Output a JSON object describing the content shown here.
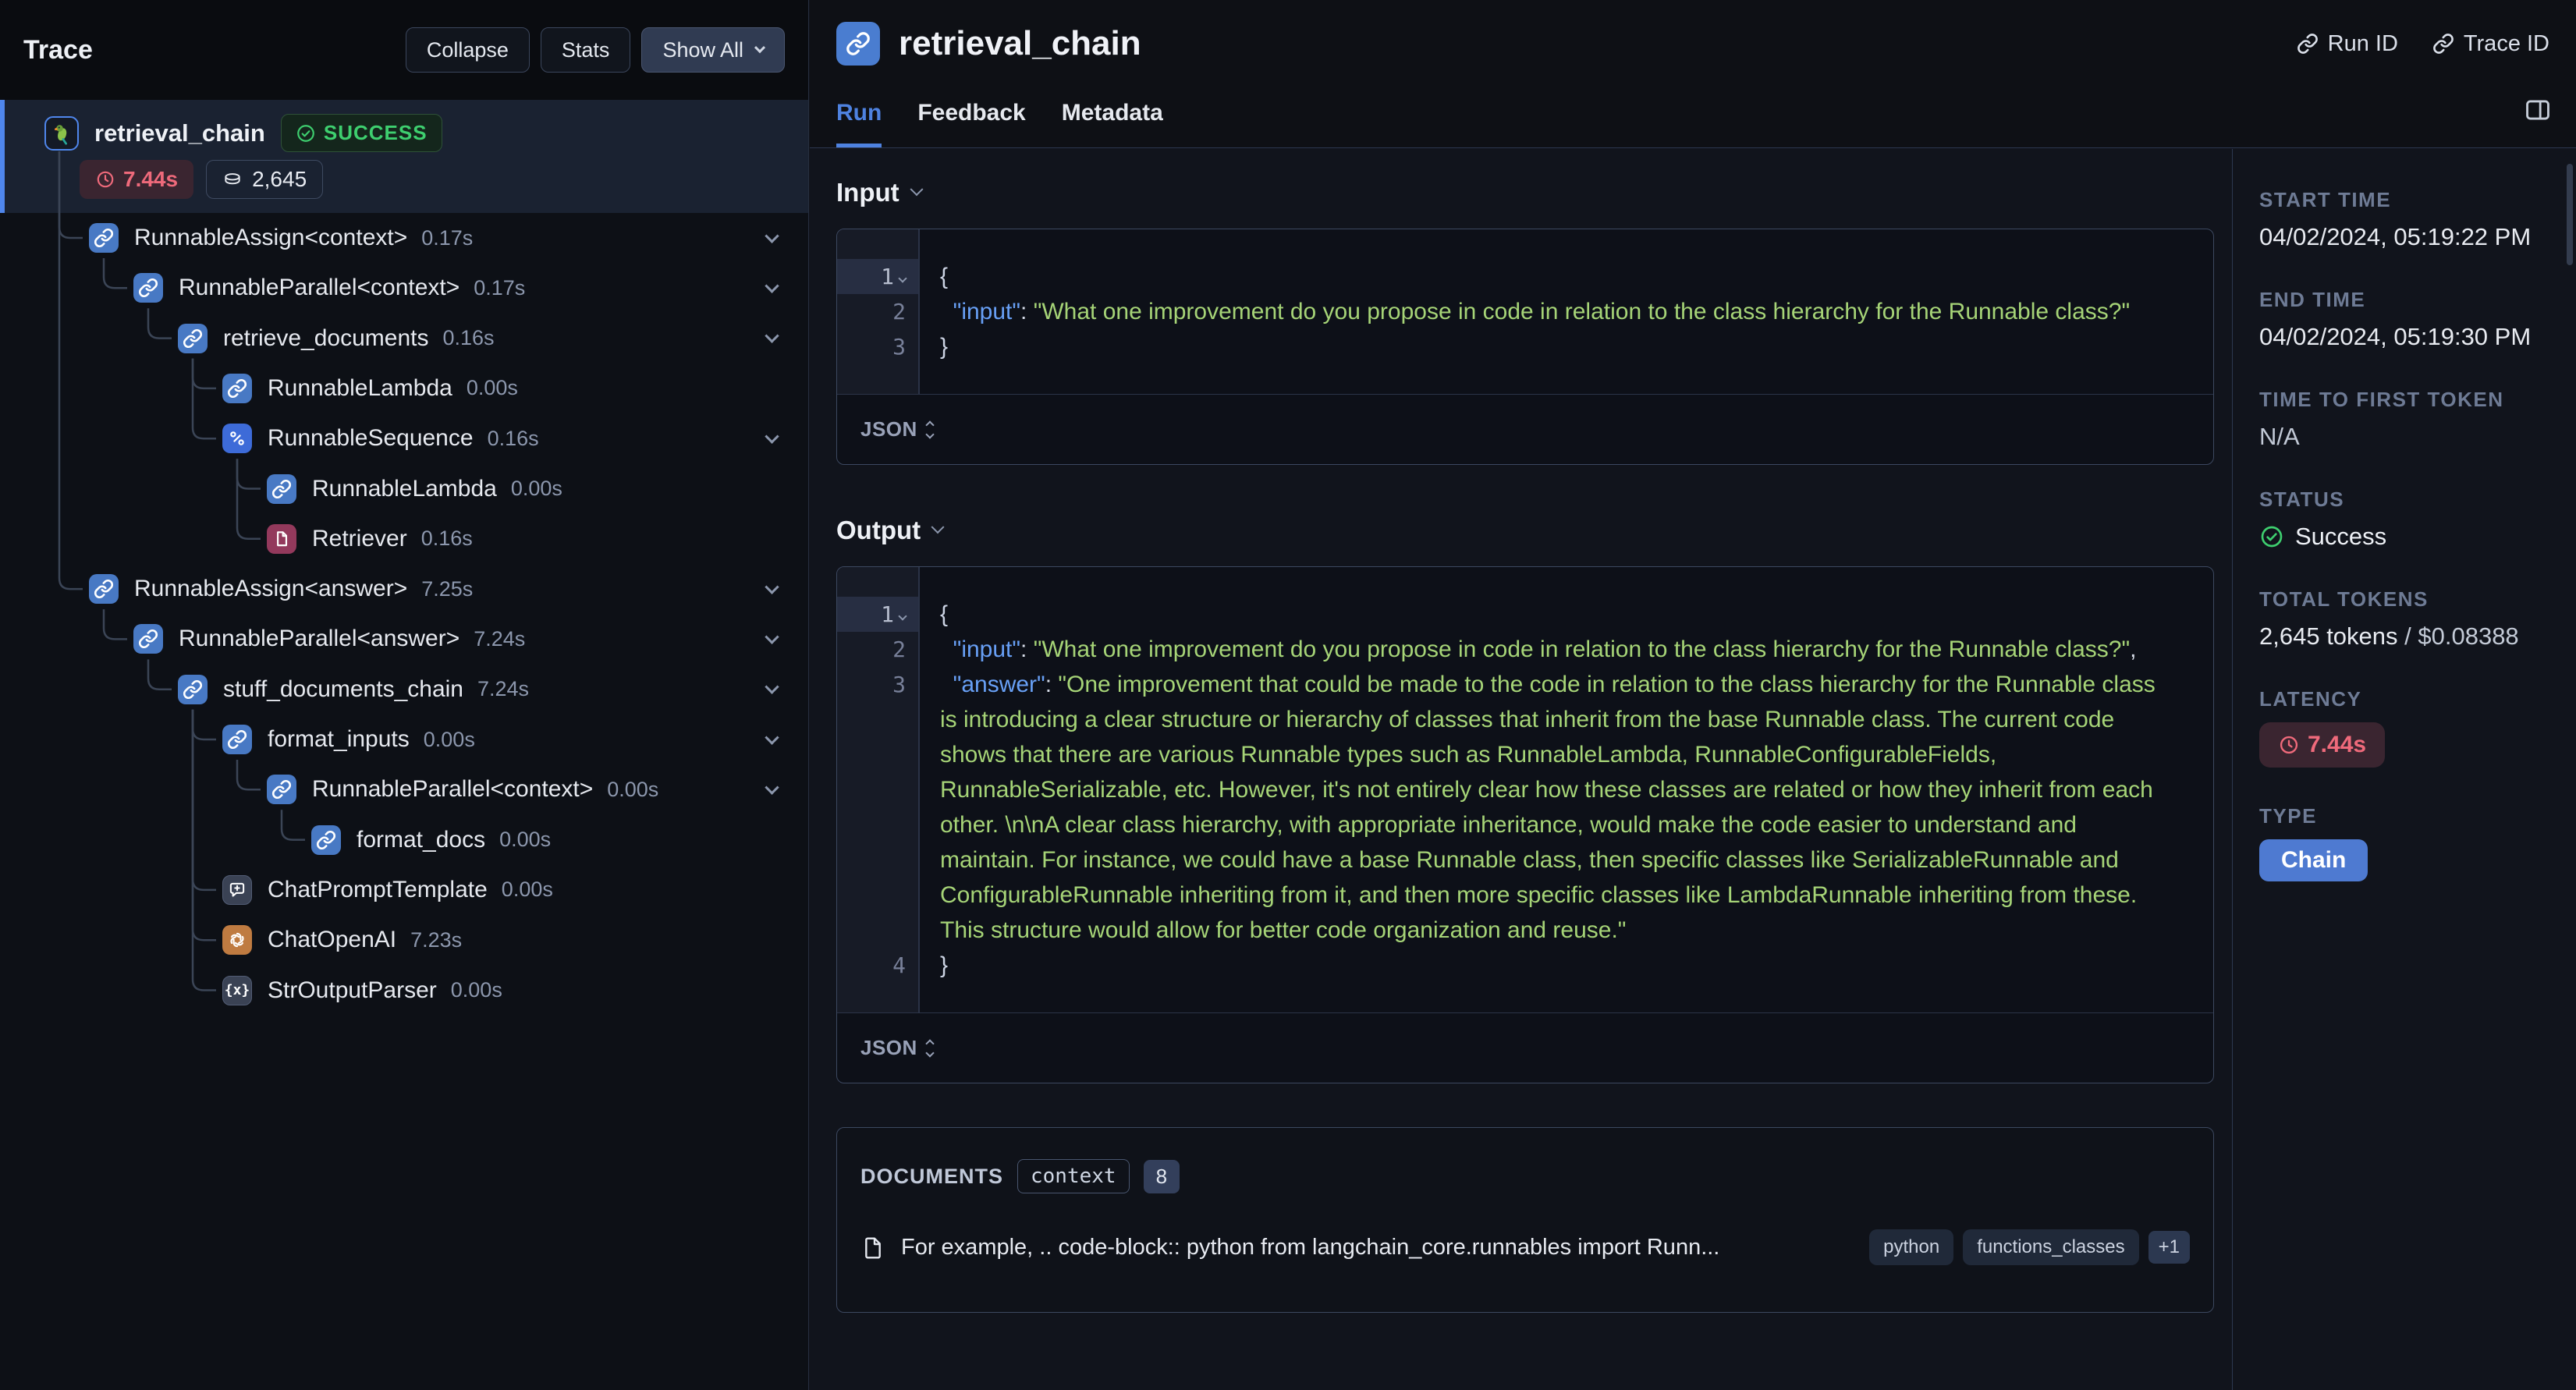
{
  "trace": {
    "title": "Trace",
    "buttons": {
      "collapse": "Collapse",
      "stats": "Stats",
      "show_all": "Show All"
    },
    "root": {
      "name": "retrieval_chain",
      "status_label": "SUCCESS",
      "latency": "7.44s",
      "tokens": "2,645"
    },
    "nodes": [
      {
        "name": "RunnableAssign<context>",
        "duration": "0.17s",
        "depth": 1,
        "parent": -1,
        "icon": "chain",
        "expandable": true
      },
      {
        "name": "RunnableParallel<context>",
        "duration": "0.17s",
        "depth": 2,
        "parent": 0,
        "icon": "chain",
        "expandable": true
      },
      {
        "name": "retrieve_documents",
        "duration": "0.16s",
        "depth": 3,
        "parent": 1,
        "icon": "chain",
        "expandable": true
      },
      {
        "name": "RunnableLambda",
        "duration": "0.00s",
        "depth": 4,
        "parent": 2,
        "icon": "chain",
        "expandable": false
      },
      {
        "name": "RunnableSequence",
        "duration": "0.16s",
        "depth": 4,
        "parent": 2,
        "icon": "sequence",
        "expandable": true
      },
      {
        "name": "RunnableLambda",
        "duration": "0.00s",
        "depth": 5,
        "parent": 4,
        "icon": "chain",
        "expandable": false
      },
      {
        "name": "Retriever",
        "duration": "0.16s",
        "depth": 5,
        "parent": 4,
        "icon": "retriever",
        "expandable": false
      },
      {
        "name": "RunnableAssign<answer>",
        "duration": "7.25s",
        "depth": 1,
        "parent": -1,
        "icon": "chain",
        "expandable": true
      },
      {
        "name": "RunnableParallel<answer>",
        "duration": "7.24s",
        "depth": 2,
        "parent": 7,
        "icon": "chain",
        "expandable": true
      },
      {
        "name": "stuff_documents_chain",
        "duration": "7.24s",
        "depth": 3,
        "parent": 8,
        "icon": "chain",
        "expandable": true
      },
      {
        "name": "format_inputs",
        "duration": "0.00s",
        "depth": 4,
        "parent": 9,
        "icon": "chain",
        "expandable": true
      },
      {
        "name": "RunnableParallel<context>",
        "duration": "0.00s",
        "depth": 5,
        "parent": 10,
        "icon": "chain",
        "expandable": true
      },
      {
        "name": "format_docs",
        "duration": "0.00s",
        "depth": 6,
        "parent": 11,
        "icon": "chain",
        "expandable": false
      },
      {
        "name": "ChatPromptTemplate",
        "duration": "0.00s",
        "depth": 4,
        "parent": 9,
        "icon": "prompt",
        "expandable": false
      },
      {
        "name": "ChatOpenAI",
        "duration": "7.23s",
        "depth": 4,
        "parent": 9,
        "icon": "openai",
        "expandable": false
      },
      {
        "name": "StrOutputParser",
        "duration": "0.00s",
        "depth": 4,
        "parent": 9,
        "icon": "parser",
        "expandable": false
      }
    ]
  },
  "main": {
    "title": "retrieval_chain",
    "actions": {
      "run_id": "Run ID",
      "trace_id": "Trace ID"
    },
    "tabs": [
      {
        "label": "Run",
        "active": true
      },
      {
        "label": "Feedback",
        "active": false
      },
      {
        "label": "Metadata",
        "active": false
      }
    ],
    "input": {
      "label": "Input",
      "format": "JSON",
      "lines": [
        {
          "n": "1",
          "active": true,
          "parts": [
            [
              "br",
              "{"
            ]
          ]
        },
        {
          "n": "2",
          "parts": [
            [
              "pn",
              "  "
            ],
            [
              "key",
              "\"input\""
            ],
            [
              "pn",
              ": "
            ],
            [
              "str",
              "\"What one improvement do you propose in code in relation to the class hierarchy for the Runnable class?\""
            ]
          ]
        },
        {
          "n": "3",
          "parts": [
            [
              "br",
              "}"
            ]
          ]
        }
      ]
    },
    "output": {
      "label": "Output",
      "format": "JSON",
      "lines": [
        {
          "n": "1",
          "active": true,
          "parts": [
            [
              "br",
              "{"
            ]
          ]
        },
        {
          "n": "2",
          "parts": [
            [
              "pn",
              "  "
            ],
            [
              "key",
              "\"input\""
            ],
            [
              "pn",
              ": "
            ],
            [
              "str",
              "\"What one improvement do you propose in code in relation to the class hierarchy for the Runnable class?\""
            ],
            [
              "pn",
              ","
            ]
          ]
        },
        {
          "n": "3",
          "parts": [
            [
              "pn",
              "  "
            ],
            [
              "key",
              "\"answer\""
            ],
            [
              "pn",
              ": "
            ],
            [
              "str",
              "\"One improvement that could be made to the code in relation to the class hierarchy for the Runnable class is introducing a clear structure or hierarchy of classes that inherit from the base Runnable class. The current code shows that there are various Runnable types such as RunnableLambda, RunnableConfigurableFields, RunnableSerializable, etc. However, it's not entirely clear how these classes are related or how they inherit from each other. \\n\\nA clear class hierarchy, with appropriate inheritance, would make the code easier to understand and maintain. For instance, we could have a base Runnable class, then specific classes like SerializableRunnable and ConfigurableRunnable inheriting from it, and then more specific classes like LambdaRunnable inheriting from these. This structure would allow for better code organization and reuse.\""
            ]
          ]
        },
        {
          "n": "4",
          "parts": [
            [
              "br",
              "}"
            ]
          ]
        }
      ]
    },
    "documents": {
      "label": "DOCUMENTS",
      "filter_badge": "context",
      "count": "8",
      "doc": {
        "text": "For example, .. code-block:: python from langchain_core.runnables import Runn...",
        "tags": [
          "python",
          "functions_classes"
        ],
        "more_badge": "+1"
      }
    }
  },
  "sidebar": {
    "start_time": {
      "label": "START TIME",
      "value": "04/02/2024, 05:19:22 PM"
    },
    "end_time": {
      "label": "END TIME",
      "value": "04/02/2024, 05:19:30 PM"
    },
    "time_to_first_token": {
      "label": "TIME TO FIRST TOKEN",
      "value": "N/A"
    },
    "status": {
      "label": "STATUS",
      "value": "Success"
    },
    "total_tokens": {
      "label": "TOTAL TOKENS",
      "tokens": "2,645 tokens",
      "separator": " / ",
      "cost": "$0.08388"
    },
    "latency": {
      "label": "LATENCY",
      "value": "7.44s"
    },
    "type": {
      "label": "TYPE",
      "value": "Chain"
    }
  },
  "colors": {
    "accent_blue": "#4e82e0",
    "success_green": "#3ecf6f",
    "error_red": "#ef6a7b",
    "string_green": "#a6d477",
    "key_blue": "#68a0f6",
    "type_badge_blue": "#4e7ad1",
    "retriever_maroon": "#93395c",
    "openai_orange": "#bf7b41"
  }
}
